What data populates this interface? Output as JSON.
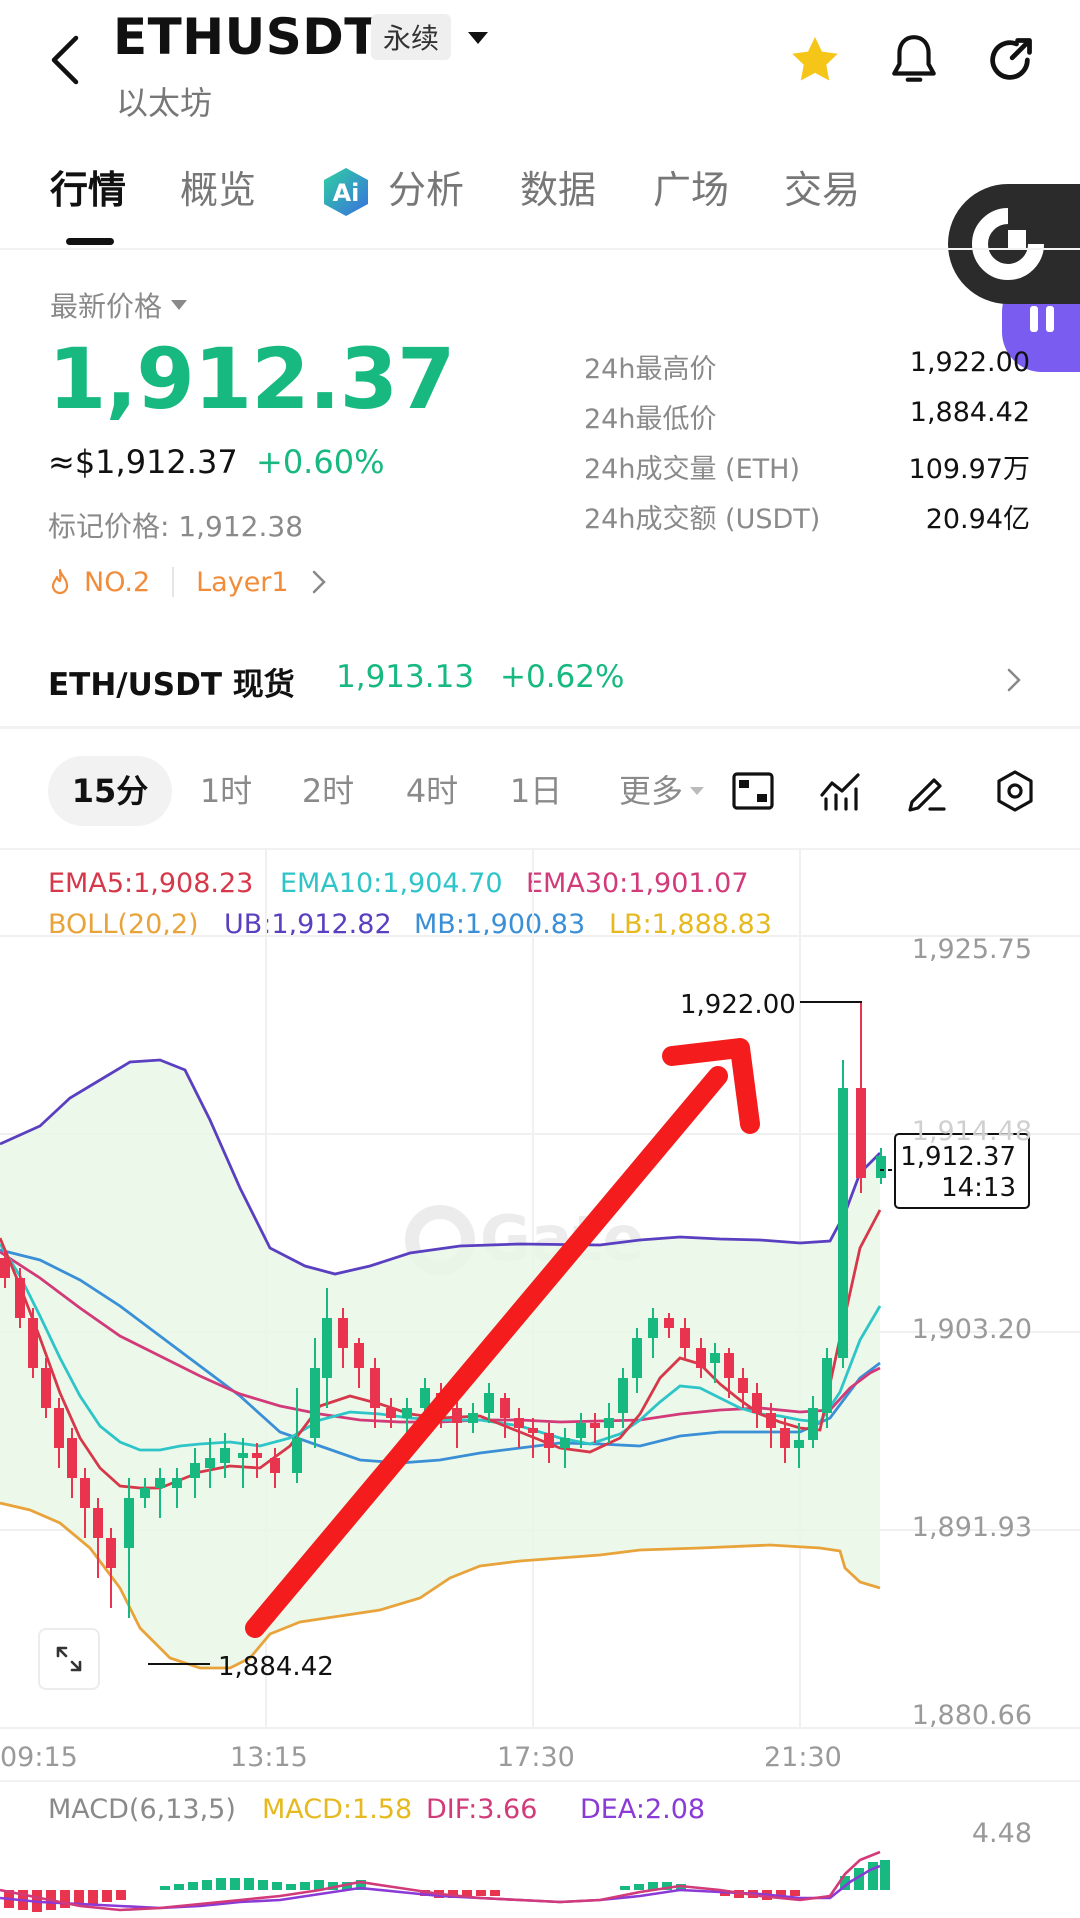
{
  "header": {
    "title": "ETHUSDT",
    "badge": "永续",
    "subtitle": "以太坊"
  },
  "tabs": [
    "行情",
    "概览",
    "分析",
    "数据",
    "广场",
    "交易"
  ],
  "price_section": {
    "label": "最新价格",
    "last_price": "1,912.37",
    "usd_price": "≈$1,912.37",
    "change_pct": "+0.60%",
    "mark_price": "标记价格: 1,912.38",
    "rank_tag": "NO.2",
    "category_tag": "Layer1"
  },
  "stats": [
    {
      "label": "24h最高价",
      "value": "1,922.00"
    },
    {
      "label": "24h最低价",
      "value": "1,884.42"
    },
    {
      "label": "24h成交量 (ETH)",
      "value": "109.97万"
    },
    {
      "label": "24h成交额 (USDT)",
      "value": "20.94亿"
    }
  ],
  "spot": {
    "label": "ETH/USDT 现货",
    "price": "1,913.13",
    "change": "+0.62%"
  },
  "timeframes": [
    "15分",
    "1时",
    "2时",
    "4时",
    "1日",
    "更多"
  ],
  "indicators": {
    "ema5": "EMA5:1,908.23",
    "ema10": "EMA10:1,904.70",
    "ema30": "EMA30:1,901.07",
    "boll": "BOLL(20,2)",
    "ub": "UB:1,912.82",
    "mb": "MB:1,900.83",
    "lb": "LB:1,888.83"
  },
  "chart_data": {
    "type": "candlestick",
    "y_axis_ticks": [
      "1,925.75",
      "1,914.48",
      "1,903.20",
      "1,891.93",
      "1,880.66"
    ],
    "x_axis_ticks": [
      "09:15",
      "13:15",
      "17:30",
      "21:30"
    ],
    "high_marker": "1,922.00",
    "low_marker": "1,884.42",
    "current_price_tag": "1,912.37",
    "countdown": "14:13",
    "ylim": [
      1880.66,
      1925.75
    ]
  },
  "macd": {
    "label": "MACD(6,13,5)",
    "macd": "MACD:1.58",
    "dif": "DIF:3.66",
    "dea": "DEA:2.08",
    "axis_top": "4.48"
  },
  "colors": {
    "up": "#17b980",
    "down": "#e8344e",
    "ema5": "#d6384a",
    "ema10": "#2ec4c8",
    "ema30": "#d23a7a",
    "boll": "#e8a33b",
    "ub": "#5a3fc0",
    "mb": "#3a8fd6",
    "lb": "#e6b91f",
    "orange_tag": "#f08c3a",
    "star": "#f5c518"
  }
}
